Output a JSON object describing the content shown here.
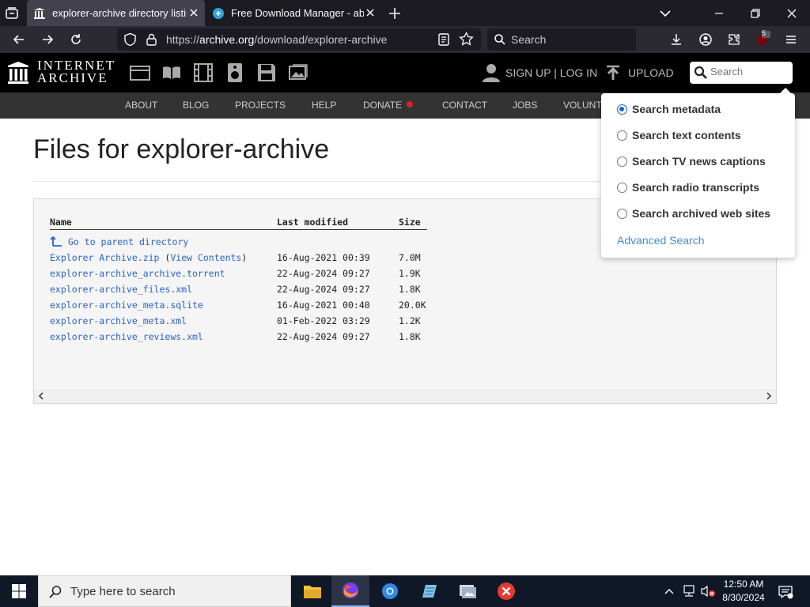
{
  "browser": {
    "tabs": [
      {
        "title": "explorer-archive directory listing",
        "active": true
      },
      {
        "title": "Free Download Manager - absol",
        "active": false
      }
    ],
    "url": {
      "prefix": "https://",
      "host": "archive.org",
      "path": "/download/explorer-archive"
    },
    "search_label": "Search",
    "badge_count": "5"
  },
  "ia": {
    "logo_line1": "INTERNET",
    "logo_line2": "ARCHIVE",
    "signup": "SIGN UP | LOG IN",
    "upload": "UPLOAD",
    "search_placeholder": "Search",
    "nav": [
      "ABOUT",
      "BLOG",
      "PROJECTS",
      "HELP",
      "DONATE",
      "CONTACT",
      "JOBS",
      "VOLUNT"
    ]
  },
  "page": {
    "title": "Files for explorer-archive",
    "columns": {
      "name": "Name",
      "modified": "Last modified",
      "size": "Size"
    },
    "parent_link": "Go to parent directory",
    "files": [
      {
        "name": "Explorer Archive.zip",
        "extra": "View Contents",
        "modified": "16-Aug-2021 00:39",
        "size": "7.0M"
      },
      {
        "name": "explorer-archive_archive.torrent",
        "extra": "",
        "modified": "22-Aug-2024 09:27",
        "size": "1.9K"
      },
      {
        "name": "explorer-archive_files.xml",
        "extra": "",
        "modified": "22-Aug-2024 09:27",
        "size": "1.8K"
      },
      {
        "name": "explorer-archive_meta.sqlite",
        "extra": "",
        "modified": "16-Aug-2021 00:40",
        "size": "20.0K"
      },
      {
        "name": "explorer-archive_meta.xml",
        "extra": "",
        "modified": "01-Feb-2022 03:29",
        "size": "1.2K"
      },
      {
        "name": "explorer-archive_reviews.xml",
        "extra": "",
        "modified": "22-Aug-2024 09:27",
        "size": "1.8K"
      }
    ]
  },
  "dropdown": {
    "options": [
      {
        "label": "Search metadata",
        "checked": true
      },
      {
        "label": "Search text contents",
        "checked": false
      },
      {
        "label": "Search TV news captions",
        "checked": false
      },
      {
        "label": "Search radio transcripts",
        "checked": false
      },
      {
        "label": "Search archived web sites",
        "checked": false
      }
    ],
    "advanced": "Advanced Search"
  },
  "taskbar": {
    "search_placeholder": "Type here to search",
    "time": "12:50 AM",
    "date": "8/30/2024"
  }
}
